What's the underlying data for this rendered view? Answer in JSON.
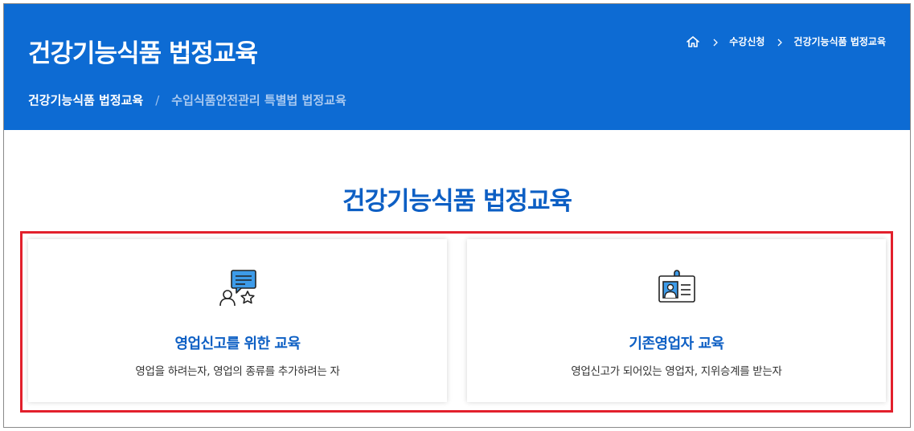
{
  "header": {
    "title": "건강기능식품 법정교육",
    "breadcrumb": {
      "home_icon": "home-icon",
      "items": [
        "수강신청",
        "건강기능식품 법정교육"
      ]
    },
    "subnav": {
      "active": "건강기능식품 법정교육",
      "separator": "/",
      "inactive": "수입식품안전관리 특별법 법정교육"
    }
  },
  "main": {
    "section_title": "건강기능식품 법정교육",
    "cards": [
      {
        "icon": "chat-person-star-icon",
        "title": "영업신고를 위한 교육",
        "description": "영업을 하려는자, 영업의 종류를 추가하려는 자"
      },
      {
        "icon": "id-badge-icon",
        "title": "기존영업자 교육",
        "description": "영업신고가 되어있는 영업자, 지위승계를 받는자"
      }
    ]
  },
  "colors": {
    "brand_blue": "#0d6bd3",
    "title_blue": "#0d5fc4",
    "highlight_red": "#e2202c"
  }
}
